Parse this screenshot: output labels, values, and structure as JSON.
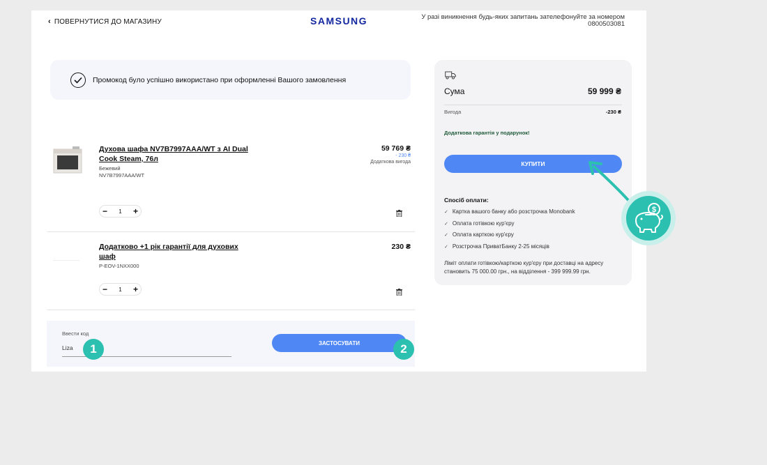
{
  "header": {
    "back_label": "ПОВЕРНУТИСЯ ДО МАГАЗИНУ",
    "logo": "SAMSUNG",
    "hotline_line1": "У разі виникнення будь-яких запитань зателефонуйте за номером",
    "hotline_number": "0800503081"
  },
  "promo_banner": {
    "text": "Промокод було успішно використано при оформленні Вашого замовлення"
  },
  "items": [
    {
      "title_line1": "Духова шафа NV7B7997AAA/WT з AI Dual",
      "title_line2": "Cook Steam, 76л",
      "color": "Бежевий",
      "sku": "NV7B7997AAA/WT",
      "price": "59 769 ₴",
      "discount": "- 230 ₴",
      "discount_label": "Додаткова вигода",
      "quantity": "1"
    },
    {
      "title_line1": "Додатково +1 рік гарантії для духових",
      "title_line2": "шаф",
      "sku": "P-EOV-1NXX000",
      "price": "230 ₴",
      "quantity": "1"
    }
  ],
  "promo_code": {
    "label": "Ввести код",
    "value": "Liza",
    "apply_label": "ЗАСТОСУВАТИ"
  },
  "summary": {
    "sum_label": "Сума",
    "sum_value": "59 999 ₴",
    "benefit_label": "Вигода",
    "benefit_value": "-230 ₴",
    "gift_note": "Додаткова гарантія у подарунок!",
    "buy_label": "КУПИТИ",
    "payment_title": "Спосіб оплати:",
    "payment_methods": [
      "Картка вашого банку або розстрочка Monobank",
      "Оплата готівкою кур'єру",
      "Оплата карткою кур'єру",
      "Розстрочка ПриватБанку 2-25 місяців"
    ],
    "limit_line1": "Ліміт оплати готівкою/карткою кур'єру при доставці на адресу",
    "limit_line2": "становить 75 000.00 грн., на відділення - 399 999.99 грн."
  },
  "annotations": {
    "badge_1": "1",
    "badge_2": "2"
  },
  "colors": {
    "accent_blue": "#4f87f5",
    "brand_blue": "#1428a0",
    "teal": "#2cc0b0",
    "panel_bg": "#f3f3f5"
  }
}
